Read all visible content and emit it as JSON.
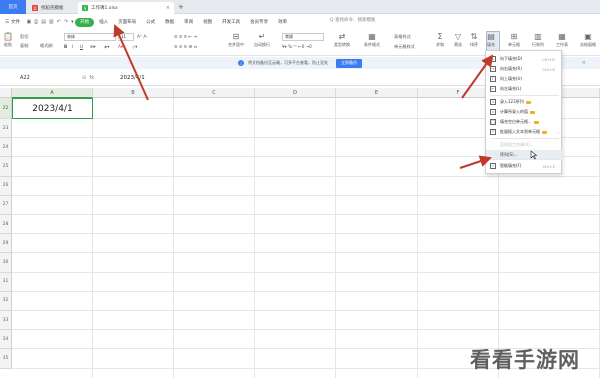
{
  "tabbar": {
    "home": "首页",
    "tabs": [
      {
        "label": "找稻壳模板",
        "icon": "D",
        "color": "#e0443c",
        "active": false
      },
      {
        "label": "工作簿1.xlsx",
        "icon": "S",
        "color": "#36b04a",
        "active": true
      }
    ],
    "new_tab": "+"
  },
  "menubar": {
    "file": "三 文件",
    "items": [
      "开始",
      "插入",
      "页面布局",
      "公式",
      "数据",
      "审阅",
      "视图",
      "开发工具",
      "会员专享",
      "效率"
    ],
    "active_index": 0,
    "search": "Q 查找命令、搜索模板"
  },
  "toolbar": {
    "paste": "粘贴",
    "cut": "剪切",
    "copy": "复制",
    "format_painter": "格式刷",
    "font_name": "宋体",
    "font_size": "11",
    "merge": "合并居中",
    "wrap": "自动换行",
    "number_format": "常规",
    "cond_format": "条件格式",
    "table_style": "表格样式",
    "cell_style": "单元格样式",
    "sum": "求和",
    "filter": "筛选",
    "sort": "排序",
    "fill": "填充",
    "cells": "单元格",
    "row_col": "行和列",
    "worksheet": "工作表",
    "freeze": "冻结窗格"
  },
  "notice": {
    "text": "将文档备份至云端，可多平台查看，防止丢失",
    "button": "立即备份"
  },
  "formulabar": {
    "cell_ref": "A22",
    "value": "2023/4/1"
  },
  "grid": {
    "columns": [
      "A",
      "B",
      "C",
      "D",
      "E",
      "F"
    ],
    "rows": [
      "22",
      "23",
      "24",
      "25",
      "26",
      "27",
      "28",
      "29",
      "30",
      "31",
      "32",
      "33",
      "34",
      "35"
    ],
    "active_value": "2023/4/1"
  },
  "dropdown": {
    "items": [
      {
        "label": "向下填充(D)",
        "shortcut": "Ctrl+D",
        "icon": "↓"
      },
      {
        "label": "向右填充(R)",
        "shortcut": "Ctrl+R",
        "icon": "→"
      },
      {
        "label": "向上填充(U)",
        "shortcut": "",
        "icon": "↑"
      },
      {
        "label": "向左填充(L)",
        "shortcut": "",
        "icon": "←"
      },
      {
        "label": "录入123序列",
        "shortcut": "",
        "icon": "1"
      },
      {
        "label": "计算所录入的值",
        "shortcut": "",
        "icon": "="
      },
      {
        "label": "填充空白单元格...",
        "shortcut": "",
        "icon": "□"
      },
      {
        "label": "批量插入文本到单元格",
        "shortcut": "",
        "icon": "T"
      },
      {
        "label": "至同组工作表(A)...",
        "shortcut": "",
        "icon": ""
      },
      {
        "label": "序列(S)...",
        "shortcut": "",
        "icon": ""
      },
      {
        "label": "智能填充(F)",
        "shortcut": "Ctrl+E",
        "icon": "⚡"
      }
    ]
  },
  "watermark": "看看手游网",
  "colors": {
    "accent_green": "#36b04a",
    "accent_blue": "#3c7cf0",
    "arrow_red": "#c0392b"
  }
}
